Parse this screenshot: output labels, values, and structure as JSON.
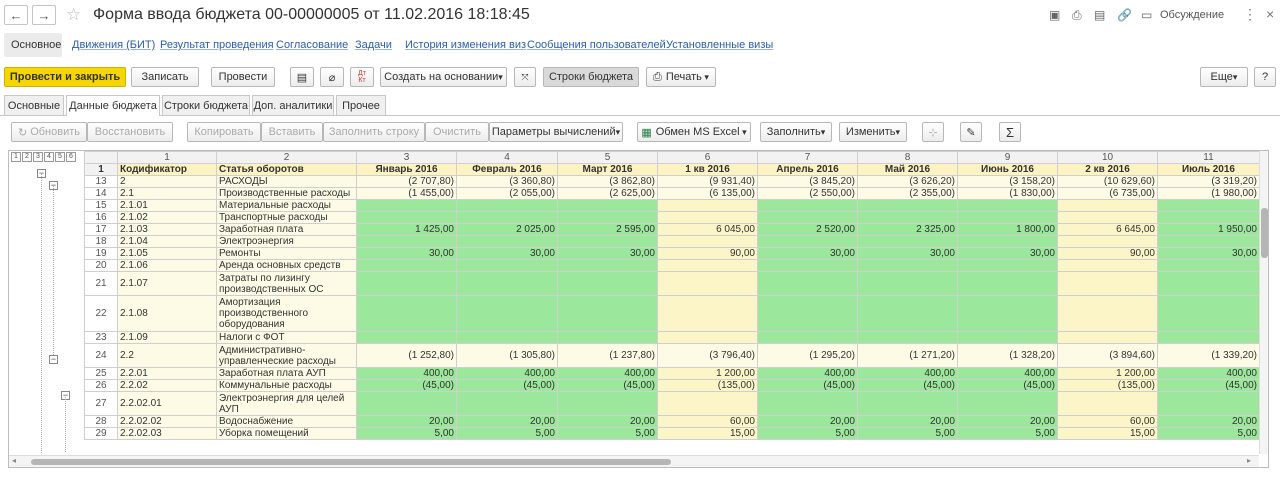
{
  "window": {
    "title": "Форма ввода бюджета 00-00000005 от 11.02.2016 18:18:45",
    "discuss": "Обсуждение"
  },
  "links": [
    "Основное",
    "Движения (БИТ)",
    "Результат проведения",
    "Согласование",
    "Задачи",
    "История изменения виз",
    "Сообщения пользователей",
    "Установленные визы"
  ],
  "toolbar": {
    "post_close": "Провести и закрыть",
    "write": "Записать",
    "post": "Провести",
    "dt_kt_top": "Дт",
    "dt_kt_bottom": "Кт",
    "create_based": "Создать на основании",
    "budget_rows": "Строки бюджета",
    "print": "Печать",
    "more": "Еще",
    "help": "?"
  },
  "tabs": [
    "Основные",
    "Данные бюджета",
    "Строки бюджета",
    "Доп. аналитики",
    "Прочее"
  ],
  "subtoolbar": {
    "refresh": "Обновить",
    "restore": "Восстановить",
    "copy": "Копировать",
    "paste": "Вставить",
    "fill_row": "Заполнить строку",
    "clear": "Очистить",
    "calc_params": "Параметры вычислений",
    "excel": "Обмен MS Excel",
    "fill": "Заполнить",
    "change": "Изменить",
    "sum": "Σ"
  },
  "grid": {
    "levels": [
      "1",
      "2",
      "3",
      "4",
      "5",
      "6"
    ],
    "colnums": [
      "1",
      "2",
      "3",
      "4",
      "5",
      "6",
      "7",
      "8",
      "9",
      "10",
      "11"
    ],
    "headers": [
      "Кодификатор",
      "Статья оборотов",
      "Январь 2016",
      "Февраль 2016",
      "Март 2016",
      "1 кв 2016",
      "Апрель 2016",
      "Май 2016",
      "Июнь 2016",
      "2 кв 2016",
      "Июль 2016"
    ],
    "rows": [
      {
        "n": "13",
        "code": "2",
        "name": "РАСХОДЫ",
        "v": [
          "(2 707,80)",
          "(3 360,80)",
          "(3 862,80)",
          "(9 931,40)",
          "(3 845,20)",
          "(3 626,20)",
          "(3 158,20)",
          "(10 629,60)",
          "(3 319,20)"
        ]
      },
      {
        "n": "14",
        "code": "2.1",
        "name": "Производственные расходы",
        "v": [
          "(1 455,00)",
          "(2 055,00)",
          "(2 625,00)",
          "(6 135,00)",
          "(2 550,00)",
          "(2 355,00)",
          "(1 830,00)",
          "(6 735,00)",
          "(1 980,00)"
        ]
      },
      {
        "n": "15",
        "code": "2.1.01",
        "name": "Материальные расходы",
        "v": [
          "",
          "",
          "",
          "",
          "",
          "",
          "",
          "",
          ""
        ]
      },
      {
        "n": "16",
        "code": "2.1.02",
        "name": "Транспортные расходы",
        "v": [
          "",
          "",
          "",
          "",
          "",
          "",
          "",
          "",
          ""
        ]
      },
      {
        "n": "17",
        "code": "2.1.03",
        "name": "Заработная плата",
        "v": [
          "1 425,00",
          "2 025,00",
          "2 595,00",
          "6 045,00",
          "2 520,00",
          "2 325,00",
          "1 800,00",
          "6 645,00",
          "1 950,00"
        ]
      },
      {
        "n": "18",
        "code": "2.1.04",
        "name": "Электроэнергия",
        "v": [
          "",
          "",
          "",
          "",
          "",
          "",
          "",
          "",
          ""
        ]
      },
      {
        "n": "19",
        "code": "2.1.05",
        "name": "Ремонты",
        "v": [
          "30,00",
          "30,00",
          "30,00",
          "90,00",
          "30,00",
          "30,00",
          "30,00",
          "90,00",
          "30,00"
        ]
      },
      {
        "n": "20",
        "code": "2.1.06",
        "name": "Аренда основных средств",
        "v": [
          "",
          "",
          "",
          "",
          "",
          "",
          "",
          "",
          ""
        ]
      },
      {
        "n": "21",
        "code": "2.1.07",
        "name": "Затраты по лизингу производственных ОС",
        "v": [
          "",
          "",
          "",
          "",
          "",
          "",
          "",
          "",
          ""
        ]
      },
      {
        "n": "22",
        "code": "2.1.08",
        "name": "Амортизация производственного оборудования",
        "v": [
          "",
          "",
          "",
          "",
          "",
          "",
          "",
          "",
          ""
        ]
      },
      {
        "n": "23",
        "code": "2.1.09",
        "name": "Налоги с ФОТ",
        "v": [
          "",
          "",
          "",
          "",
          "",
          "",
          "",
          "",
          ""
        ]
      },
      {
        "n": "24",
        "code": "2.2",
        "name": "Административно-управленческие расходы",
        "v": [
          "(1 252,80)",
          "(1 305,80)",
          "(1 237,80)",
          "(3 796,40)",
          "(1 295,20)",
          "(1 271,20)",
          "(1 328,20)",
          "(3 894,60)",
          "(1 339,20)"
        ]
      },
      {
        "n": "25",
        "code": "2.2.01",
        "name": "Заработная плата АУП",
        "v": [
          "400,00",
          "400,00",
          "400,00",
          "1 200,00",
          "400,00",
          "400,00",
          "400,00",
          "1 200,00",
          "400,00"
        ]
      },
      {
        "n": "26",
        "code": "2.2.02",
        "name": "Коммунальные расходы",
        "v": [
          "(45,00)",
          "(45,00)",
          "(45,00)",
          "(135,00)",
          "(45,00)",
          "(45,00)",
          "(45,00)",
          "(135,00)",
          "(45,00)"
        ]
      },
      {
        "n": "27",
        "code": "2.2.02.01",
        "name": "Электроэнергия для целей АУП",
        "v": [
          "",
          "",
          "",
          "",
          "",
          "",
          "",
          "",
          ""
        ]
      },
      {
        "n": "28",
        "code": "2.2.02.02",
        "name": "Водоснабжение",
        "v": [
          "20,00",
          "20,00",
          "20,00",
          "60,00",
          "20,00",
          "20,00",
          "20,00",
          "60,00",
          "20,00"
        ]
      },
      {
        "n": "29",
        "code": "2.2.02.03",
        "name": "Уборка помещений",
        "v": [
          "5,00",
          "5,00",
          "5,00",
          "15,00",
          "5,00",
          "5,00",
          "5,00",
          "15,00",
          "5,00"
        ]
      }
    ]
  }
}
